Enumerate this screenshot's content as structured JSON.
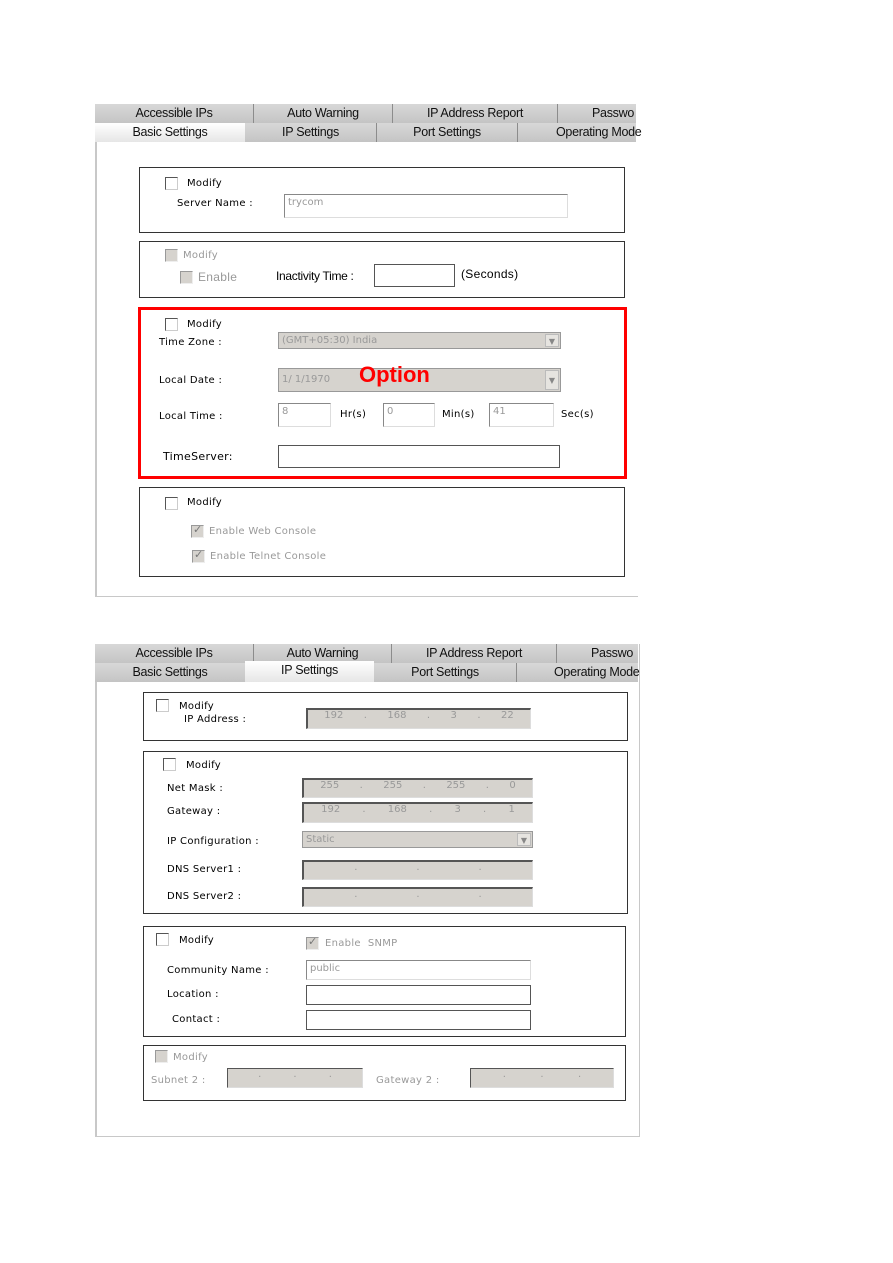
{
  "tabs_row1": [
    "Accessible IPs",
    "Auto Warning",
    "IP Address Report",
    "Passwo"
  ],
  "tabs_row2": [
    "Basic Settings",
    "IP Settings",
    "Port Settings",
    "Operating Mode"
  ],
  "basic": {
    "server": {
      "modify": "Modify",
      "label": "Server Name :",
      "value": "trycom"
    },
    "inactivity": {
      "modify": "Modify",
      "enable": "Enable",
      "label": "Inactivity Time :",
      "value": "",
      "unit": "(Seconds)"
    },
    "time": {
      "modify": "Modify",
      "tz_label": "Time Zone :",
      "tz_value": "(GMT+05:30) India",
      "date_label": "Local Date :",
      "date_value": "1/ 1/1970",
      "option": "Option",
      "time_label": "Local Time :",
      "hr": "8",
      "hr_unit": "Hr(s)",
      "min": "0",
      "min_unit": "Min(s)",
      "sec": "41",
      "sec_unit": "Sec(s)",
      "server_label": "TimeServer:",
      "server_value": "",
      "highlight_color": "#ff0000"
    },
    "console": {
      "modify": "Modify",
      "web": "Enable Web Console",
      "telnet": "Enable Telnet Console"
    }
  },
  "ip": {
    "addr": {
      "modify": "Modify",
      "label": "IP Address :",
      "value": [
        "192",
        "168",
        "3",
        "22"
      ]
    },
    "net": {
      "modify": "Modify",
      "mask_label": "Net Mask :",
      "mask": [
        "255",
        "255",
        "255",
        "0"
      ],
      "gw_label": "Gateway :",
      "gw": [
        "192",
        "168",
        "3",
        "1"
      ],
      "cfg_label": "IP Configuration :",
      "cfg_value": "Static",
      "dns1_label": "DNS Server1 :",
      "dns2_label": "DNS Server2 :"
    },
    "snmp": {
      "modify": "Modify",
      "enable": "Enable  SNMP",
      "community_label": "Community Name :",
      "community": "public",
      "location_label": "Location :",
      "contact_label": "Contact :"
    },
    "subnet": {
      "modify": "Modify",
      "subnet_label": "Subnet 2 :",
      "gw_label": "Gateway 2 :"
    }
  }
}
